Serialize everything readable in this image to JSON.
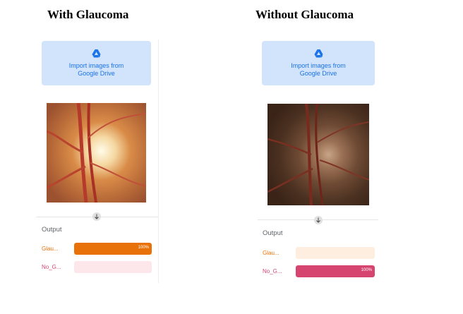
{
  "left": {
    "heading": "With Glaucoma",
    "import_button": "Import images from\nGoogle Drive",
    "output_label": "Output",
    "results": [
      {
        "label": "Glau...",
        "percent": 100,
        "percent_text": "100%",
        "color": "#e8710a",
        "track": "#fdeee0",
        "label_color": "#e8710a"
      },
      {
        "label": "No_G...",
        "percent": 0,
        "percent_text": "",
        "color": "#d64570",
        "track": "#fde7ea",
        "label_color": "#d64570"
      }
    ]
  },
  "right": {
    "heading": "Without Glaucoma",
    "import_button": "Import images from\nGoogle Drive",
    "output_label": "Output",
    "results": [
      {
        "label": "Glau...",
        "percent": 0,
        "percent_text": "",
        "color": "#e8710a",
        "track": "#fdeee0",
        "label_color": "#e8710a"
      },
      {
        "label": "No_G...",
        "percent": 100,
        "percent_text": "100%",
        "color": "#d64570",
        "track": "#fde7ea",
        "label_color": "#d64570"
      }
    ]
  },
  "icons": {
    "drive": "google-drive-add-icon",
    "arrow": "arrow-down-icon"
  }
}
